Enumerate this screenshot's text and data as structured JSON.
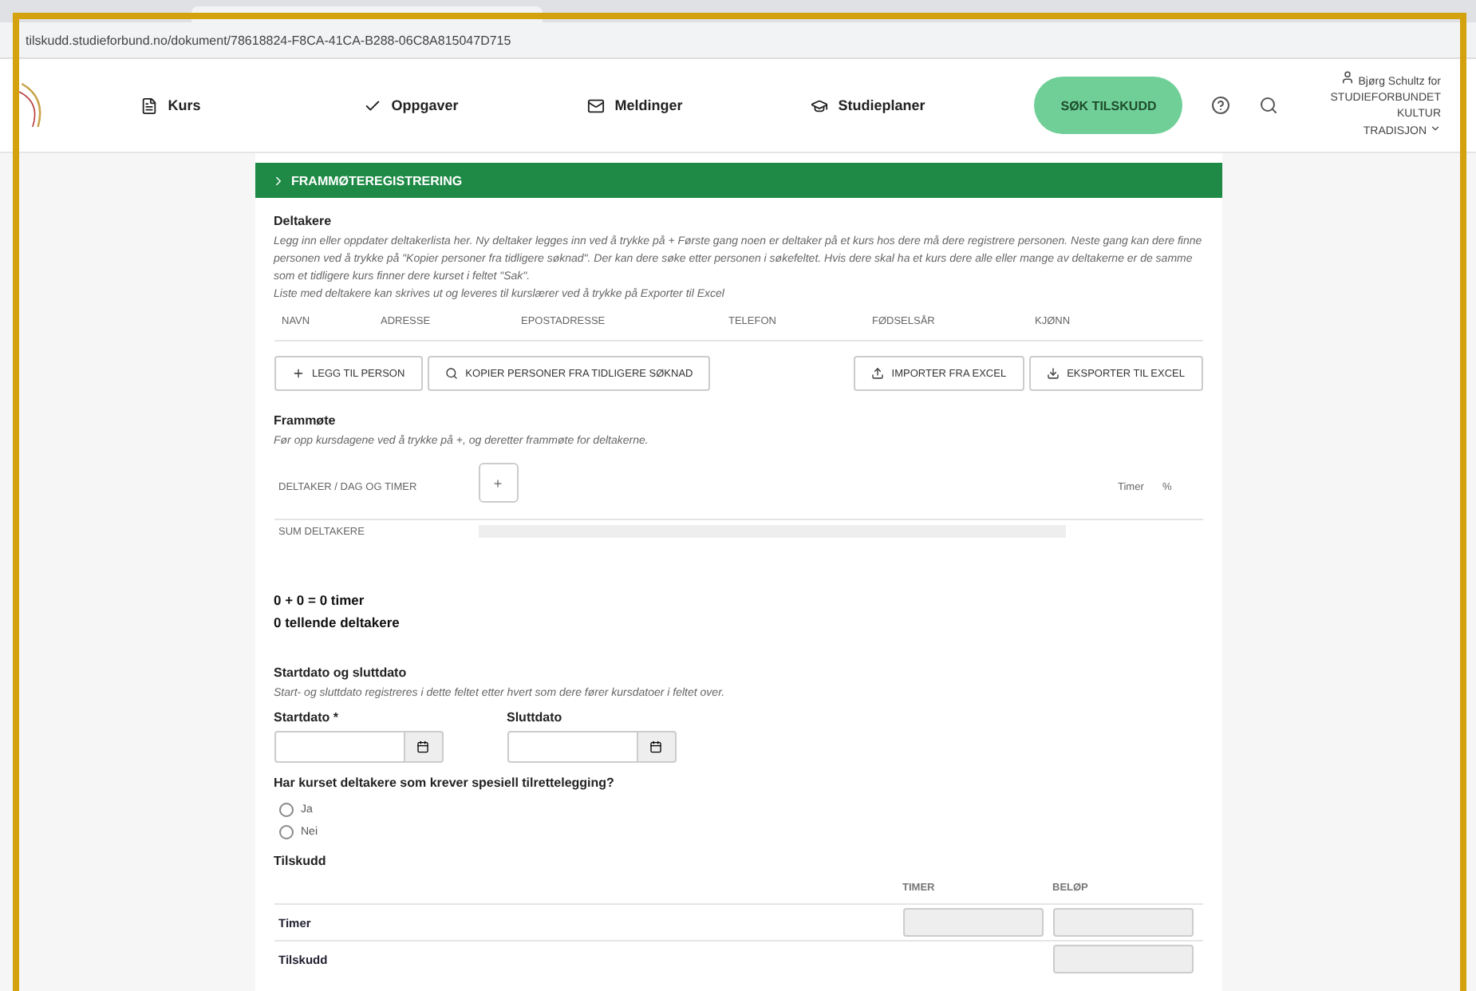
{
  "browser": {
    "url": "tilskudd.studieforbund.no/dokument/78618824-F8CA-41CA-B288-06C8A815047D715"
  },
  "nav": {
    "items": [
      {
        "label": "Kurs"
      },
      {
        "label": "Oppgaver"
      },
      {
        "label": "Meldinger"
      },
      {
        "label": "Studieplaner"
      }
    ],
    "cta": "SØK TILSKUDD",
    "user_line1": "Bjørg Schultz for",
    "user_line2": "STUDIEFORBUNDET KULTUR",
    "user_line3": "TRADISJON"
  },
  "section": {
    "title": "FRAMMØTEREGISTRERING",
    "expanded": true
  },
  "deltakere": {
    "title": "Deltakere",
    "help": [
      "Legg inn eller oppdater deltakerlista her. Ny deltaker legges inn ved å trykke på + Første gang noen er deltaker på et kurs hos dere må dere registrere personen. Neste gang kan dere finne personen ved å trykke på \"Kopier personer fra tidligere søknad\". Der kan dere søke etter personen i søkefeltet. Hvis dere skal ha et kurs dere alle eller mange av deltakerne er de samme som et tidligere kurs finner dere kurset i feltet \"Sak\".",
      "Liste med deltakere kan skrives ut og leveres til kurslærer ved å trykke på Exporter til Excel"
    ],
    "columns": [
      "NAVN",
      "ADRESSE",
      "EPOSTADRESSE",
      "TELEFON",
      "FØDSELSÅR",
      "KJØNN"
    ],
    "buttons_left": [
      {
        "label": "LEGG TIL PERSON"
      },
      {
        "label": "KOPIER PERSONER FRA TIDLIGERE SØKNAD"
      }
    ],
    "buttons_right": [
      {
        "label": "IMPORTER FRA EXCEL"
      },
      {
        "label": "EKSPORTER TIL EXCEL"
      }
    ]
  },
  "frammote": {
    "title": "Frammøte",
    "help": "Før opp kursdagene ved å trykke på +, og deretter frammøte for deltakerne.",
    "header": "DELTAKER / DAG OG TIMER",
    "add": "+",
    "col_timer": "Timer",
    "col_pct": "%",
    "sum_label": "SUM DELTAKERE",
    "total": "0 + 0 = 0 timer",
    "counted": "0 tellende deltakere"
  },
  "dates": {
    "title": "Startdato og sluttdato",
    "help": "Start- og sluttdato registreres i dette feltet etter hvert som dere fører kursdatoer i feltet over.",
    "fields": [
      {
        "label": "Startdato *"
      },
      {
        "label": "Sluttdato"
      }
    ]
  },
  "question": {
    "label": "Har kurset deltakere som krever spesiell tilrettelegging?",
    "options": [
      {
        "label": "Ja",
        "selected": false
      },
      {
        "label": "Nei",
        "selected": false
      }
    ]
  },
  "tilskudd": {
    "title": "Tilskudd",
    "columns": [
      "TIMER",
      "BELØP"
    ],
    "rows": [
      {
        "label": "Timer",
        "kind": "both"
      },
      {
        "label": "Tilskudd",
        "kind": "amount"
      }
    ]
  }
}
